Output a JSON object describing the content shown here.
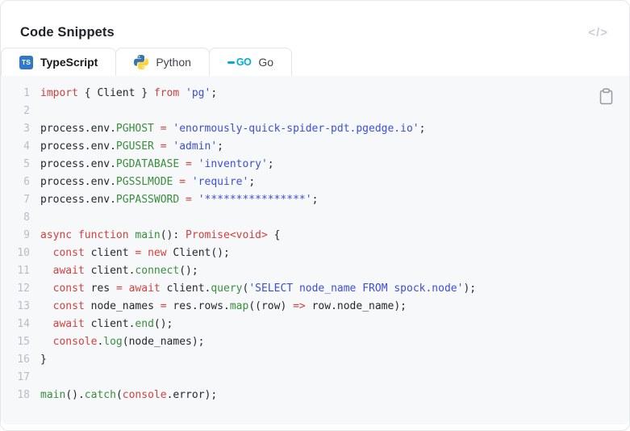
{
  "header": {
    "title": "Code Snippets",
    "code_glyph": "</>"
  },
  "tabs": [
    {
      "id": "typescript",
      "label": "TypeScript",
      "active": true,
      "icon": "typescript-icon"
    },
    {
      "id": "python",
      "label": "Python",
      "active": false,
      "icon": "python-icon"
    },
    {
      "id": "go",
      "label": "Go",
      "active": false,
      "icon": "go-icon"
    }
  ],
  "icons": {
    "ts_badge_text": "TS",
    "go_logo_text": "GO"
  },
  "colors": {
    "keyword": "#d2413e",
    "identifier_green": "#3a8e3c",
    "string_blue": "#3d4ed8",
    "plain_text": "#24292e",
    "line_number": "#b9bec5",
    "code_background": "#f6f8fa",
    "typescript_blue": "#3178c6",
    "python_blue": "#3776ab",
    "python_yellow": "#ffd43b",
    "go_cyan": "#00acd7"
  },
  "code": {
    "language": "typescript",
    "lines": [
      {
        "n": 1,
        "t": [
          [
            "k",
            "import"
          ],
          [
            "p",
            " { Client } "
          ],
          [
            "k",
            "from"
          ],
          [
            "p",
            " "
          ],
          [
            "s",
            "'pg'"
          ],
          [
            "p",
            ";"
          ]
        ]
      },
      {
        "n": 2,
        "t": []
      },
      {
        "n": 3,
        "t": [
          [
            "p",
            "process.env."
          ],
          [
            "g",
            "PGHOST"
          ],
          [
            "p",
            " "
          ],
          [
            "k",
            "="
          ],
          [
            "p",
            " "
          ],
          [
            "s",
            "'enormously-quick-spider-pdt.pgedge.io'"
          ],
          [
            "p",
            ";"
          ]
        ]
      },
      {
        "n": 4,
        "t": [
          [
            "p",
            "process.env."
          ],
          [
            "g",
            "PGUSER"
          ],
          [
            "p",
            " "
          ],
          [
            "k",
            "="
          ],
          [
            "p",
            " "
          ],
          [
            "s",
            "'admin'"
          ],
          [
            "p",
            ";"
          ]
        ]
      },
      {
        "n": 5,
        "t": [
          [
            "p",
            "process.env."
          ],
          [
            "g",
            "PGDATABASE"
          ],
          [
            "p",
            " "
          ],
          [
            "k",
            "="
          ],
          [
            "p",
            " "
          ],
          [
            "s",
            "'inventory'"
          ],
          [
            "p",
            ";"
          ]
        ]
      },
      {
        "n": 6,
        "t": [
          [
            "p",
            "process.env."
          ],
          [
            "g",
            "PGSSLMODE"
          ],
          [
            "p",
            " "
          ],
          [
            "k",
            "="
          ],
          [
            "p",
            " "
          ],
          [
            "s",
            "'require'"
          ],
          [
            "p",
            ";"
          ]
        ]
      },
      {
        "n": 7,
        "t": [
          [
            "p",
            "process.env."
          ],
          [
            "g",
            "PGPASSWORD"
          ],
          [
            "p",
            " "
          ],
          [
            "k",
            "="
          ],
          [
            "p",
            " "
          ],
          [
            "s",
            "'****************'"
          ],
          [
            "p",
            ";"
          ]
        ]
      },
      {
        "n": 8,
        "t": []
      },
      {
        "n": 9,
        "t": [
          [
            "k",
            "async"
          ],
          [
            "p",
            " "
          ],
          [
            "k",
            "function"
          ],
          [
            "p",
            " "
          ],
          [
            "g",
            "main"
          ],
          [
            "p",
            "(): "
          ],
          [
            "k",
            "Promise<void>"
          ],
          [
            "p",
            " {"
          ]
        ]
      },
      {
        "n": 10,
        "t": [
          [
            "p",
            "  "
          ],
          [
            "k",
            "const"
          ],
          [
            "p",
            " client "
          ],
          [
            "k",
            "="
          ],
          [
            "p",
            " "
          ],
          [
            "k",
            "new"
          ],
          [
            "p",
            " Client();"
          ]
        ]
      },
      {
        "n": 11,
        "t": [
          [
            "p",
            "  "
          ],
          [
            "k",
            "await"
          ],
          [
            "p",
            " client."
          ],
          [
            "g",
            "connect"
          ],
          [
            "p",
            "();"
          ]
        ]
      },
      {
        "n": 12,
        "t": [
          [
            "p",
            "  "
          ],
          [
            "k",
            "const"
          ],
          [
            "p",
            " res "
          ],
          [
            "k",
            "="
          ],
          [
            "p",
            " "
          ],
          [
            "k",
            "await"
          ],
          [
            "p",
            " client."
          ],
          [
            "g",
            "query"
          ],
          [
            "p",
            "("
          ],
          [
            "s",
            "'SELECT node_name FROM spock.node'"
          ],
          [
            "p",
            ");"
          ]
        ]
      },
      {
        "n": 13,
        "t": [
          [
            "p",
            "  "
          ],
          [
            "k",
            "const"
          ],
          [
            "p",
            " node_names "
          ],
          [
            "k",
            "="
          ],
          [
            "p",
            " res.rows."
          ],
          [
            "g",
            "map"
          ],
          [
            "p",
            "((row) "
          ],
          [
            "k",
            "=>"
          ],
          [
            "p",
            " row.node_name);"
          ]
        ]
      },
      {
        "n": 14,
        "t": [
          [
            "p",
            "  "
          ],
          [
            "k",
            "await"
          ],
          [
            "p",
            " client."
          ],
          [
            "g",
            "end"
          ],
          [
            "p",
            "();"
          ]
        ]
      },
      {
        "n": 15,
        "t": [
          [
            "p",
            "  "
          ],
          [
            "k",
            "console"
          ],
          [
            "p",
            "."
          ],
          [
            "g",
            "log"
          ],
          [
            "p",
            "(node_names);"
          ]
        ]
      },
      {
        "n": 16,
        "t": [
          [
            "p",
            "}"
          ]
        ]
      },
      {
        "n": 17,
        "t": []
      },
      {
        "n": 18,
        "t": [
          [
            "g",
            "main"
          ],
          [
            "p",
            "()."
          ],
          [
            "g",
            "catch"
          ],
          [
            "p",
            "("
          ],
          [
            "k",
            "console"
          ],
          [
            "p",
            ".error);"
          ]
        ]
      }
    ]
  }
}
